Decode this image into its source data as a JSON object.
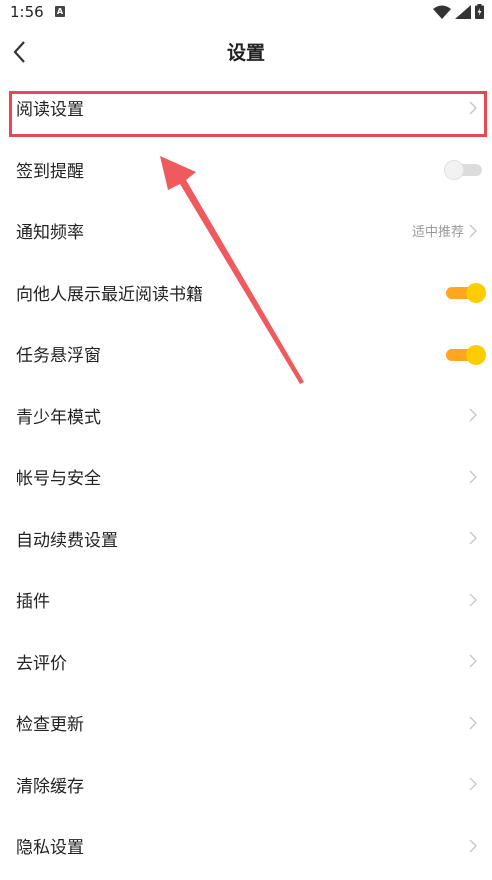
{
  "status_bar": {
    "time": "1:56",
    "notification_icon": "A"
  },
  "header": {
    "title": "设置"
  },
  "rows": [
    {
      "label": "阅读设置",
      "type": "link"
    },
    {
      "label": "签到提醒",
      "type": "toggle",
      "on": false
    },
    {
      "label": "通知频率",
      "type": "link",
      "value": "适中推荐"
    },
    {
      "label": "向他人展示最近阅读书籍",
      "type": "toggle",
      "on": true
    },
    {
      "label": "任务悬浮窗",
      "type": "toggle",
      "on": true
    },
    {
      "label": "青少年模式",
      "type": "link"
    },
    {
      "label": "帐号与安全",
      "type": "link"
    },
    {
      "label": "自动续费设置",
      "type": "link"
    },
    {
      "label": "插件",
      "type": "link"
    },
    {
      "label": "去评价",
      "type": "link"
    },
    {
      "label": "检查更新",
      "type": "link"
    },
    {
      "label": "清除缓存",
      "type": "link"
    },
    {
      "label": "隐私设置",
      "type": "link"
    }
  ],
  "colors": {
    "toggle_on": "#ffa51f",
    "knob_on": "#ffcc00",
    "annotation": "#e8494f"
  }
}
